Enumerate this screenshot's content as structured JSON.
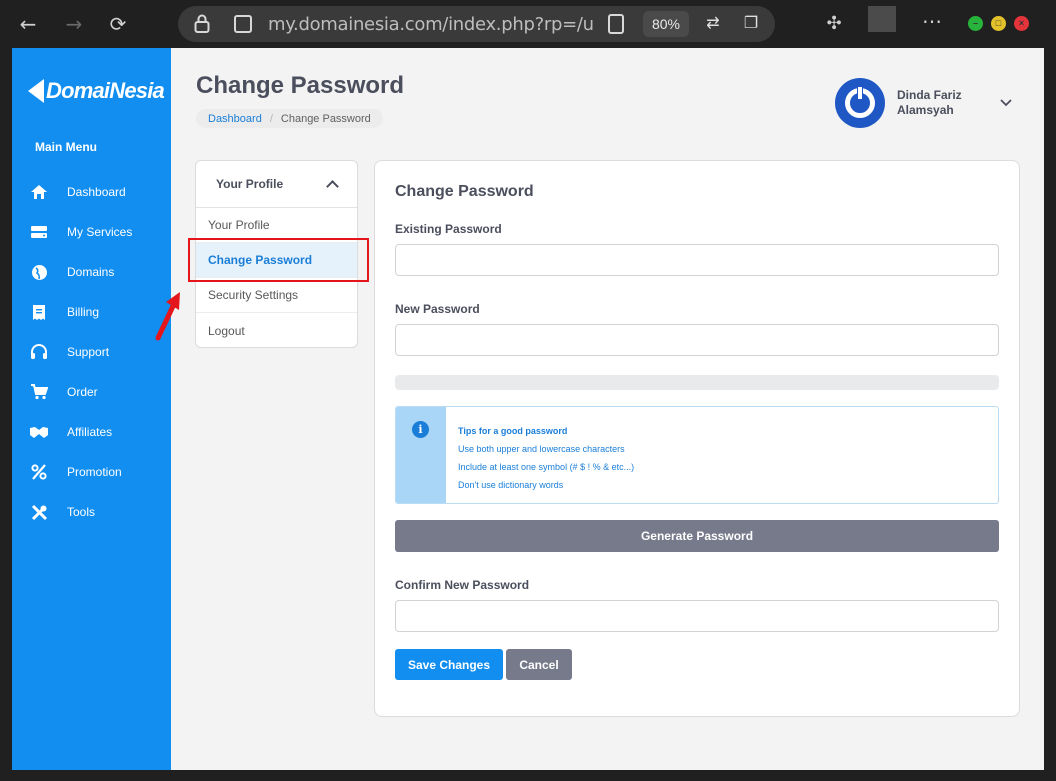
{
  "browser": {
    "url": "my.domainesia.com/index.php?rp=/user/pa",
    "zoom": "80%",
    "icons": [
      "back-icon",
      "forward-icon",
      "reload-icon",
      "lock-icon",
      "site-info-icon",
      "reader-icon",
      "translate-icon",
      "collections-icon",
      "extensions-icon",
      "more-icon"
    ]
  },
  "sidebar": {
    "logo": "DomaiNesia",
    "menu_title": "Main Menu",
    "items": [
      {
        "label": "Dashboard",
        "icon": "home-icon"
      },
      {
        "label": "My Services",
        "icon": "server-icon"
      },
      {
        "label": "Domains",
        "icon": "globe-icon"
      },
      {
        "label": "Billing",
        "icon": "receipt-icon"
      },
      {
        "label": "Support",
        "icon": "headset-icon"
      },
      {
        "label": "Order",
        "icon": "cart-icon"
      },
      {
        "label": "Affiliates",
        "icon": "handshake-icon"
      },
      {
        "label": "Promotion",
        "icon": "percent-icon"
      },
      {
        "label": "Tools",
        "icon": "tools-icon"
      }
    ]
  },
  "header": {
    "title": "Change Password",
    "breadcrumb": {
      "link": "Dashboard",
      "current": "Change Password"
    },
    "user_first": "Dinda Fariz",
    "user_last": "Alamsyah"
  },
  "profile_nav": {
    "heading": "Your Profile",
    "items": [
      "Your Profile",
      "Change Password",
      "Security Settings",
      "Logout"
    ],
    "active": "Change Password"
  },
  "form": {
    "title": "Change Password",
    "existing_label": "Existing Password",
    "existing_value": "",
    "new_label": "New Password",
    "new_value": "",
    "tips_title": "Tips for a good password",
    "tips": [
      "Use both upper and lowercase characters",
      "Include at least one symbol (# $ ! % & etc...)",
      "Don't use dictionary words"
    ],
    "generate_label": "Generate Password",
    "confirm_label": "Confirm New Password",
    "confirm_value": "",
    "save_label": "Save Changes",
    "cancel_label": "Cancel"
  },
  "colors": {
    "brand_blue": "#118ef0",
    "annotation_red": "#e5161b",
    "secondary_gray": "#767a8a"
  }
}
